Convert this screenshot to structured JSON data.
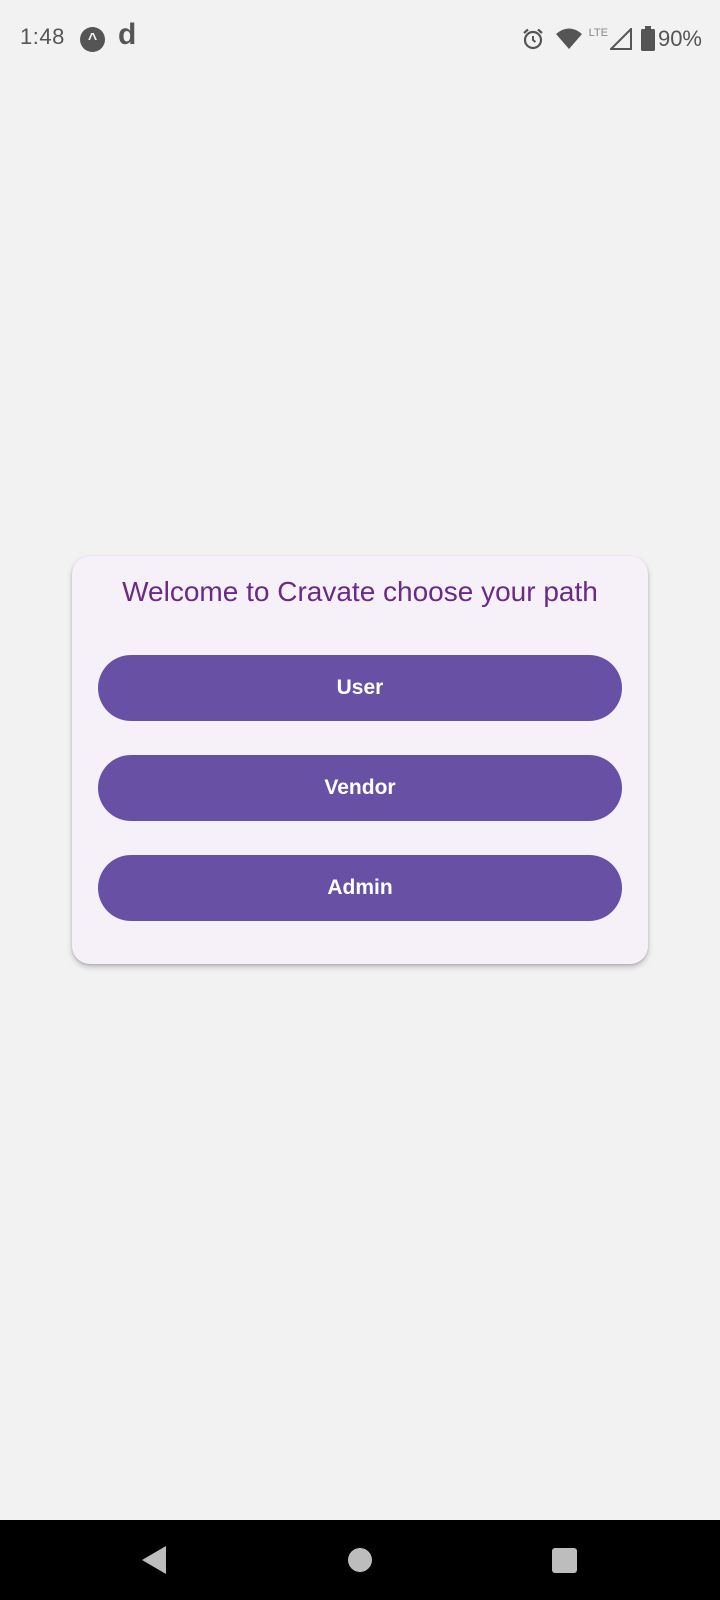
{
  "status_bar": {
    "time": "1:48",
    "notification_icons": [
      "app-a-icon",
      "app-d-icon"
    ],
    "notif_a_glyph": "^",
    "notif_d_glyph": "d",
    "network_label": "LTE",
    "battery_percent": "90%"
  },
  "card": {
    "title": "Welcome to Cravate choose your path",
    "buttons": {
      "user": "User",
      "vendor": "Vendor",
      "admin": "Admin"
    }
  },
  "colors": {
    "background": "#f2f2f2",
    "card_background": "#f6f1f8",
    "title_color": "#6a2a85",
    "button_color": "#6850a4",
    "button_text": "#ffffff",
    "nav_bar": "#000000"
  },
  "nav_bar": {
    "buttons": [
      "back-icon",
      "home-icon",
      "recents-icon"
    ]
  }
}
